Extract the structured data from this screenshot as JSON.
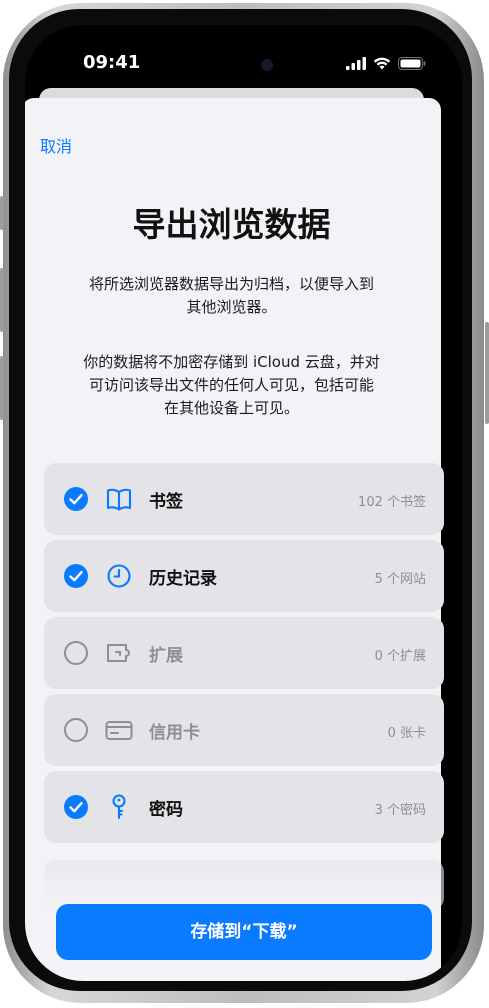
{
  "status_bar": {
    "time": "09:41"
  },
  "sheet": {
    "cancel_label": "取消",
    "title": "导出浏览数据",
    "desc_line1": "将所选浏览器数据导出为归档，以便导入到",
    "desc_line2": "其他浏览器。",
    "desc2_line1": "你的数据将不加密存储到 iCloud 云盘，并对",
    "desc2_line2": "可访问该导出文件的任何人可见，包括可能",
    "desc2_line3": "在其他设备上可见。",
    "items": [
      {
        "label": "书签",
        "count": "102 个书签",
        "checked": true,
        "icon": "book-icon"
      },
      {
        "label": "历史记录",
        "count": "5 个网站",
        "checked": true,
        "icon": "clock-icon"
      },
      {
        "label": "扩展",
        "count": "0 个扩展",
        "checked": false,
        "icon": "extension-icon"
      },
      {
        "label": "信用卡",
        "count": "0 张卡",
        "checked": false,
        "icon": "credit-card-icon"
      },
      {
        "label": "密码",
        "count": "3 个密码",
        "checked": true,
        "icon": "key-icon"
      }
    ],
    "save_label": "存储到“下载”"
  },
  "colors": {
    "accent": "#0a7aff",
    "sheet_bg": "#f2f2f7",
    "row_bg": "#e3e3e8",
    "muted": "#8e8e93"
  }
}
